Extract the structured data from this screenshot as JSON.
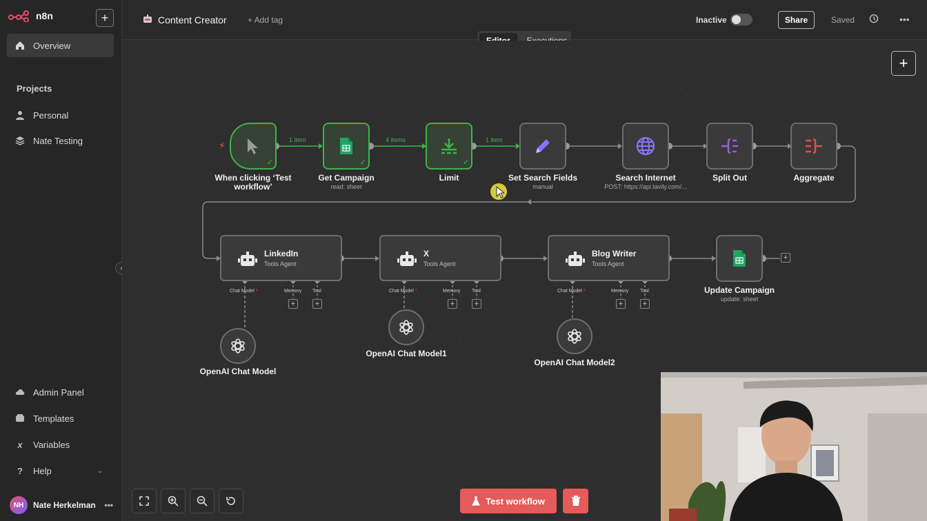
{
  "app": {
    "name": "n8n"
  },
  "sidebar": {
    "overview": "Overview",
    "projects_heading": "Projects",
    "projects": [
      {
        "label": "Personal"
      },
      {
        "label": "Nate Testing"
      }
    ],
    "bottom": [
      {
        "label": "Admin Panel"
      },
      {
        "label": "Templates"
      },
      {
        "label": "Variables"
      },
      {
        "label": "Help"
      }
    ],
    "user": {
      "initials": "NH",
      "name": "Nate Herkelman"
    }
  },
  "header": {
    "workflow_title": "Content Creator",
    "add_tag": "+ Add tag",
    "status": "Inactive",
    "share": "Share",
    "saved": "Saved",
    "tabs": [
      {
        "label": "Editor",
        "active": true
      },
      {
        "label": "Executions",
        "active": false
      }
    ]
  },
  "workflow": {
    "nodes": [
      {
        "label": "When clicking ‘Test workflow’",
        "sub": "",
        "icon": "cursor-icon",
        "done": true
      },
      {
        "label": "Get Campaign",
        "sub": "read: sheet",
        "icon": "google-sheets-icon",
        "done": true
      },
      {
        "label": "Limit",
        "sub": "",
        "icon": "limit-icon",
        "done": true
      },
      {
        "label": "Set Search Fields",
        "sub": "manual",
        "icon": "pencil-icon",
        "done": false
      },
      {
        "label": "Search Internet",
        "sub": "POST: https://api.tavily.com/...",
        "icon": "globe-icon",
        "done": false
      },
      {
        "label": "Split Out",
        "sub": "",
        "icon": "split-out-icon",
        "done": false
      },
      {
        "label": "Aggregate",
        "sub": "",
        "icon": "aggregate-icon",
        "done": false
      }
    ],
    "connection_labels": [
      "1 item",
      "4 items",
      "1 item"
    ],
    "agents": [
      {
        "title": "LinkedIn",
        "sub": "Tools Agent"
      },
      {
        "title": "X",
        "sub": "Tools Agent"
      },
      {
        "title": "Blog Writer",
        "sub": "Tools Agent"
      }
    ],
    "slot_labels": {
      "chat_model": "Chat Model",
      "memory": "Memory",
      "tool": "Tool",
      "required_mark": "*"
    },
    "models": [
      {
        "label": "OpenAI Chat Model"
      },
      {
        "label": "OpenAI Chat Model1"
      },
      {
        "label": "OpenAI Chat Model2"
      }
    ],
    "final_node": {
      "label": "Update Campaign",
      "sub": "update: sheet",
      "icon": "google-sheets-icon"
    }
  },
  "footer": {
    "test_workflow": "Test workflow"
  },
  "colors": {
    "success": "#3eb44a",
    "danger": "#e55a5a",
    "brand": "#ea4b71"
  }
}
